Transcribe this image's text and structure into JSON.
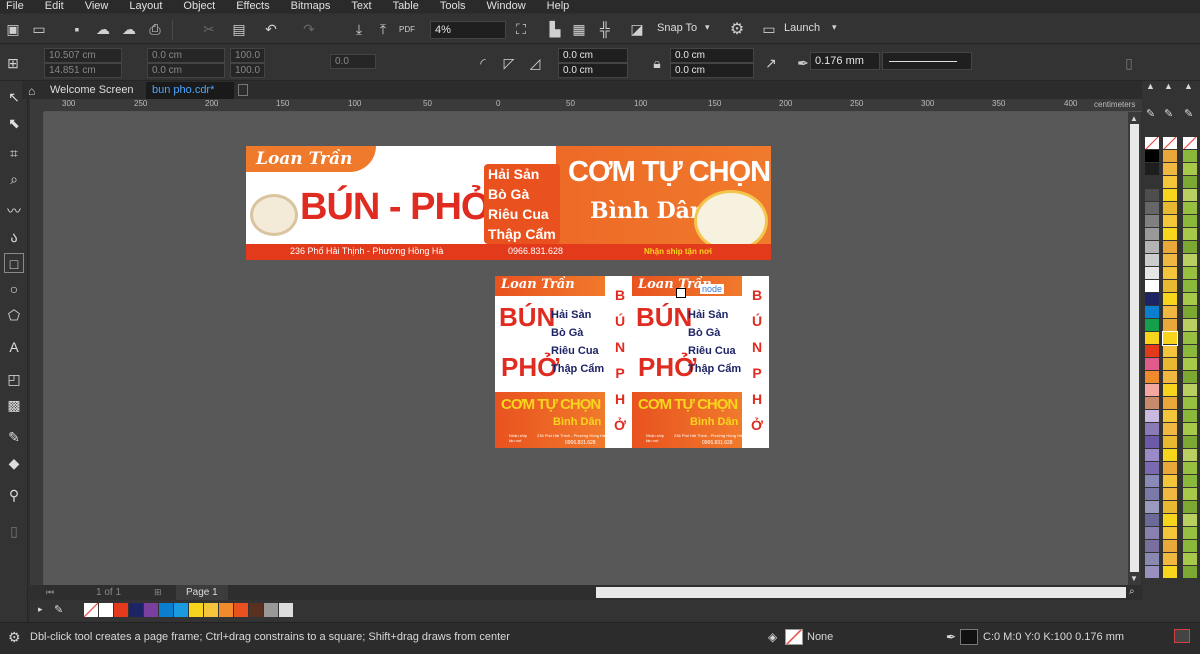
{
  "menu": [
    "File",
    "Edit",
    "View",
    "Layout",
    "Object",
    "Effects",
    "Bitmaps",
    "Text",
    "Table",
    "Tools",
    "Window",
    "Help"
  ],
  "toolbar": {
    "zoom": "4%",
    "snap_to": "Snap To",
    "launch": "Launch"
  },
  "property_bar": {
    "x": "10.507 cm",
    "y": "14.851 cm",
    "w": "0.0 cm",
    "h": "0.0 cm",
    "sx": "100.0",
    "sy": "100.0",
    "angle": "0.0",
    "corner_x1": "0.0 cm",
    "corner_y1": "0.0 cm",
    "corner_x2": "0.0 cm",
    "corner_y2": "0.0 cm",
    "outline_width": "0.176 mm"
  },
  "tabs": {
    "welcome": "Welcome Screen",
    "doc": "bun pho.cdr*"
  },
  "ruler": {
    "h_ticks": [
      "300",
      "250",
      "200",
      "150",
      "100",
      "50",
      "0",
      "50",
      "100",
      "150",
      "200",
      "250",
      "300",
      "350",
      "400"
    ],
    "unit": "centimeters"
  },
  "pages": {
    "counter": "1 of 1",
    "page_tab": "Page 1"
  },
  "status": {
    "hint": "Dbl-click tool creates a page frame; Ctrl+drag constrains to a square; Shift+drag draws from center",
    "fill": "None",
    "outline": "C:0 M:0 Y:0 K:100  0.176 mm"
  },
  "cursor_label": "node",
  "banner": {
    "brand": "Loan Trần",
    "title": "BÚN - PHỞ",
    "items": [
      "Hải Sản",
      "Bò Gà",
      "Riêu Cua",
      "Thập Cẩm"
    ],
    "headline": "CƠM TỰ CHỌN",
    "sub": "Bình Dân",
    "address": "236 Phố Hải Thịnh - Phường Hồng Hà",
    "phone": "0966.831.628",
    "delivery": "Nhận ship tận nơi"
  },
  "flyer": {
    "brand": "Loan Trần",
    "bun": "BÚN",
    "pho": "PHỞ",
    "items": [
      "Hải Sản",
      "Bò Gà",
      "Riêu Cua",
      "Thập Cẩm"
    ],
    "headline": "CƠM TỰ CHỌN",
    "sub": "Bình Dân",
    "side": [
      "B",
      "Ú",
      "N",
      "P",
      "H",
      "Ở"
    ],
    "ship": "Nhận ship tận nơi",
    "address": "236 Phố Hải Thịnh - Phường Hồng Hà",
    "phone": "0966.831.628"
  },
  "colors": {
    "accent": "#e9521f",
    "red": "#e02b20",
    "navy": "#1d2466",
    "yellow": "#f7d51d"
  }
}
